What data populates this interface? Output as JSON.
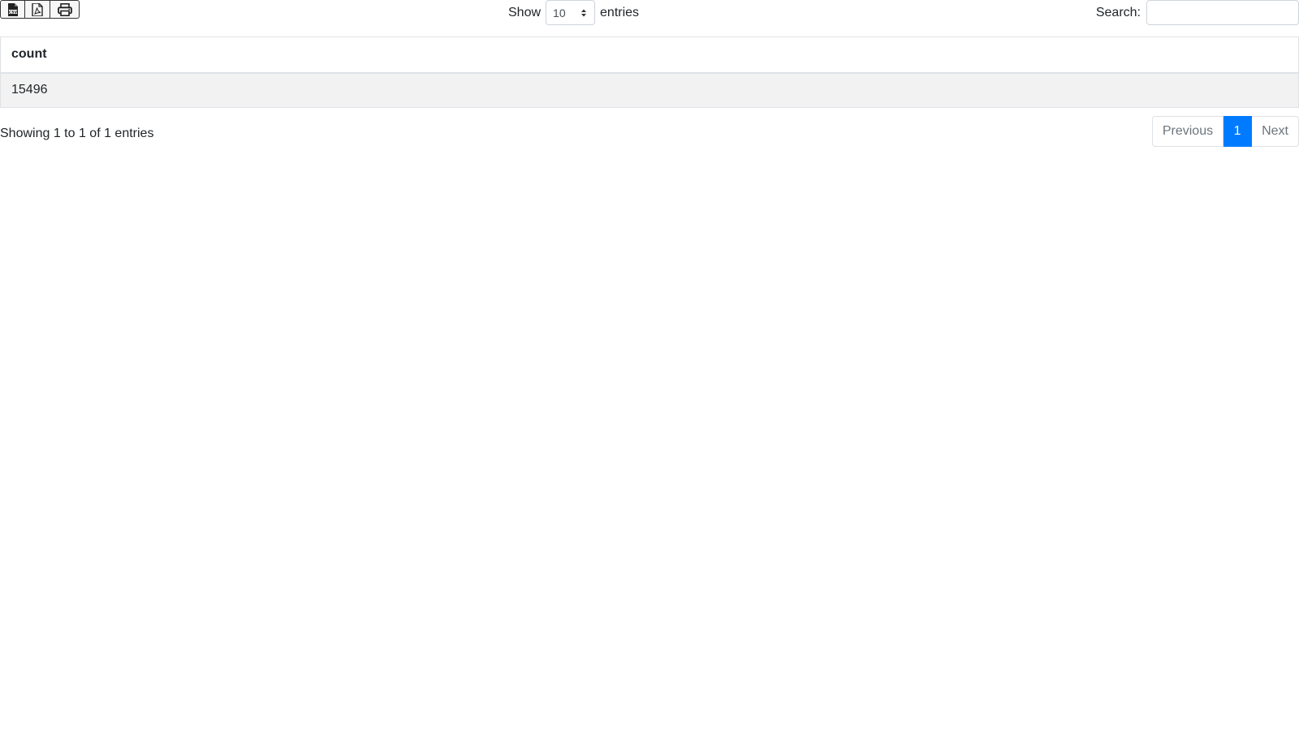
{
  "export": {
    "csv_icon": "csv-file-icon",
    "pdf_icon": "pdf-file-icon",
    "print_icon": "printer-icon"
  },
  "length": {
    "show_label": "Show",
    "selected": "10",
    "entries_label": "entries"
  },
  "search": {
    "label": "Search:",
    "value": "",
    "placeholder": ""
  },
  "table": {
    "columns": [
      "count"
    ],
    "rows": [
      [
        "15496"
      ]
    ]
  },
  "info": {
    "text": "Showing 1 to 1 of 1 entries"
  },
  "pagination": {
    "previous": "Previous",
    "pages": [
      "1"
    ],
    "next": "Next"
  },
  "colors": {
    "accent": "#007bff",
    "row_stripe": "#f2f2f2",
    "border": "#dee2e6"
  }
}
